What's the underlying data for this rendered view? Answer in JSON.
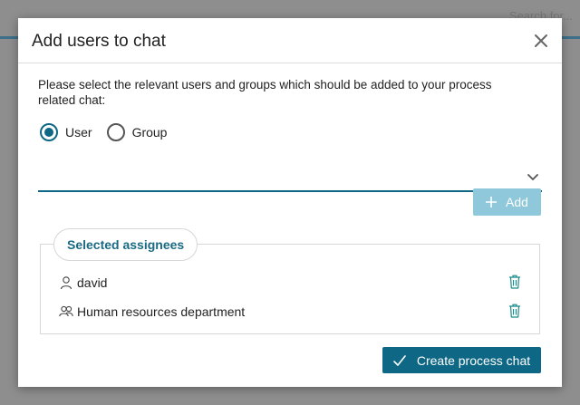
{
  "backdrop": {
    "corner_text": "Search for..."
  },
  "dialog": {
    "title": "Add users to chat",
    "instructions": "Please select the relevant users and groups which should be added to your process related chat:",
    "radio": {
      "user_label": "User",
      "group_label": "Group",
      "selected": "User"
    },
    "select": {
      "value": ""
    },
    "add_label": "Add",
    "assignees": {
      "legend": "Selected assignees",
      "items": [
        {
          "name": "david",
          "type": "user",
          "icon": "user-icon"
        },
        {
          "name": "Human resources department",
          "type": "group",
          "icon": "group-icon"
        }
      ]
    },
    "create_label": "Create process chat"
  },
  "colors": {
    "primary": "#0d6785",
    "primary_disabled": "#8fc8da",
    "icon_teal": "#1a8a8a"
  }
}
